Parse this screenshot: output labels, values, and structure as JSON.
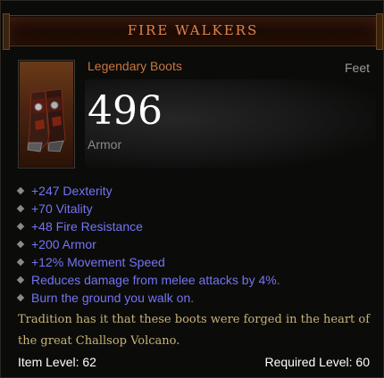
{
  "item": {
    "name": "FIRE WALKERS",
    "type": "Legendary Boots",
    "slot": "Feet",
    "armor_value": "496",
    "armor_label": "Armor",
    "icon": "boots-icon",
    "colors": {
      "title": "#e0834a",
      "type": "#c8763e",
      "affix": "#7474f4",
      "flavor": "#c7b377"
    }
  },
  "affixes": [
    "+247 Dexterity",
    "+70 Vitality",
    "+48 Fire Resistance",
    "+200 Armor",
    "+12% Movement Speed",
    "Reduces damage from melee attacks by 4%.",
    "Burn the ground you walk on."
  ],
  "flavor_text": "Tradition has it that these boots were forged in the heart of the great Challsop Volcano.",
  "footer": {
    "item_level": "Item Level: 62",
    "required_level": "Required Level: 60"
  }
}
